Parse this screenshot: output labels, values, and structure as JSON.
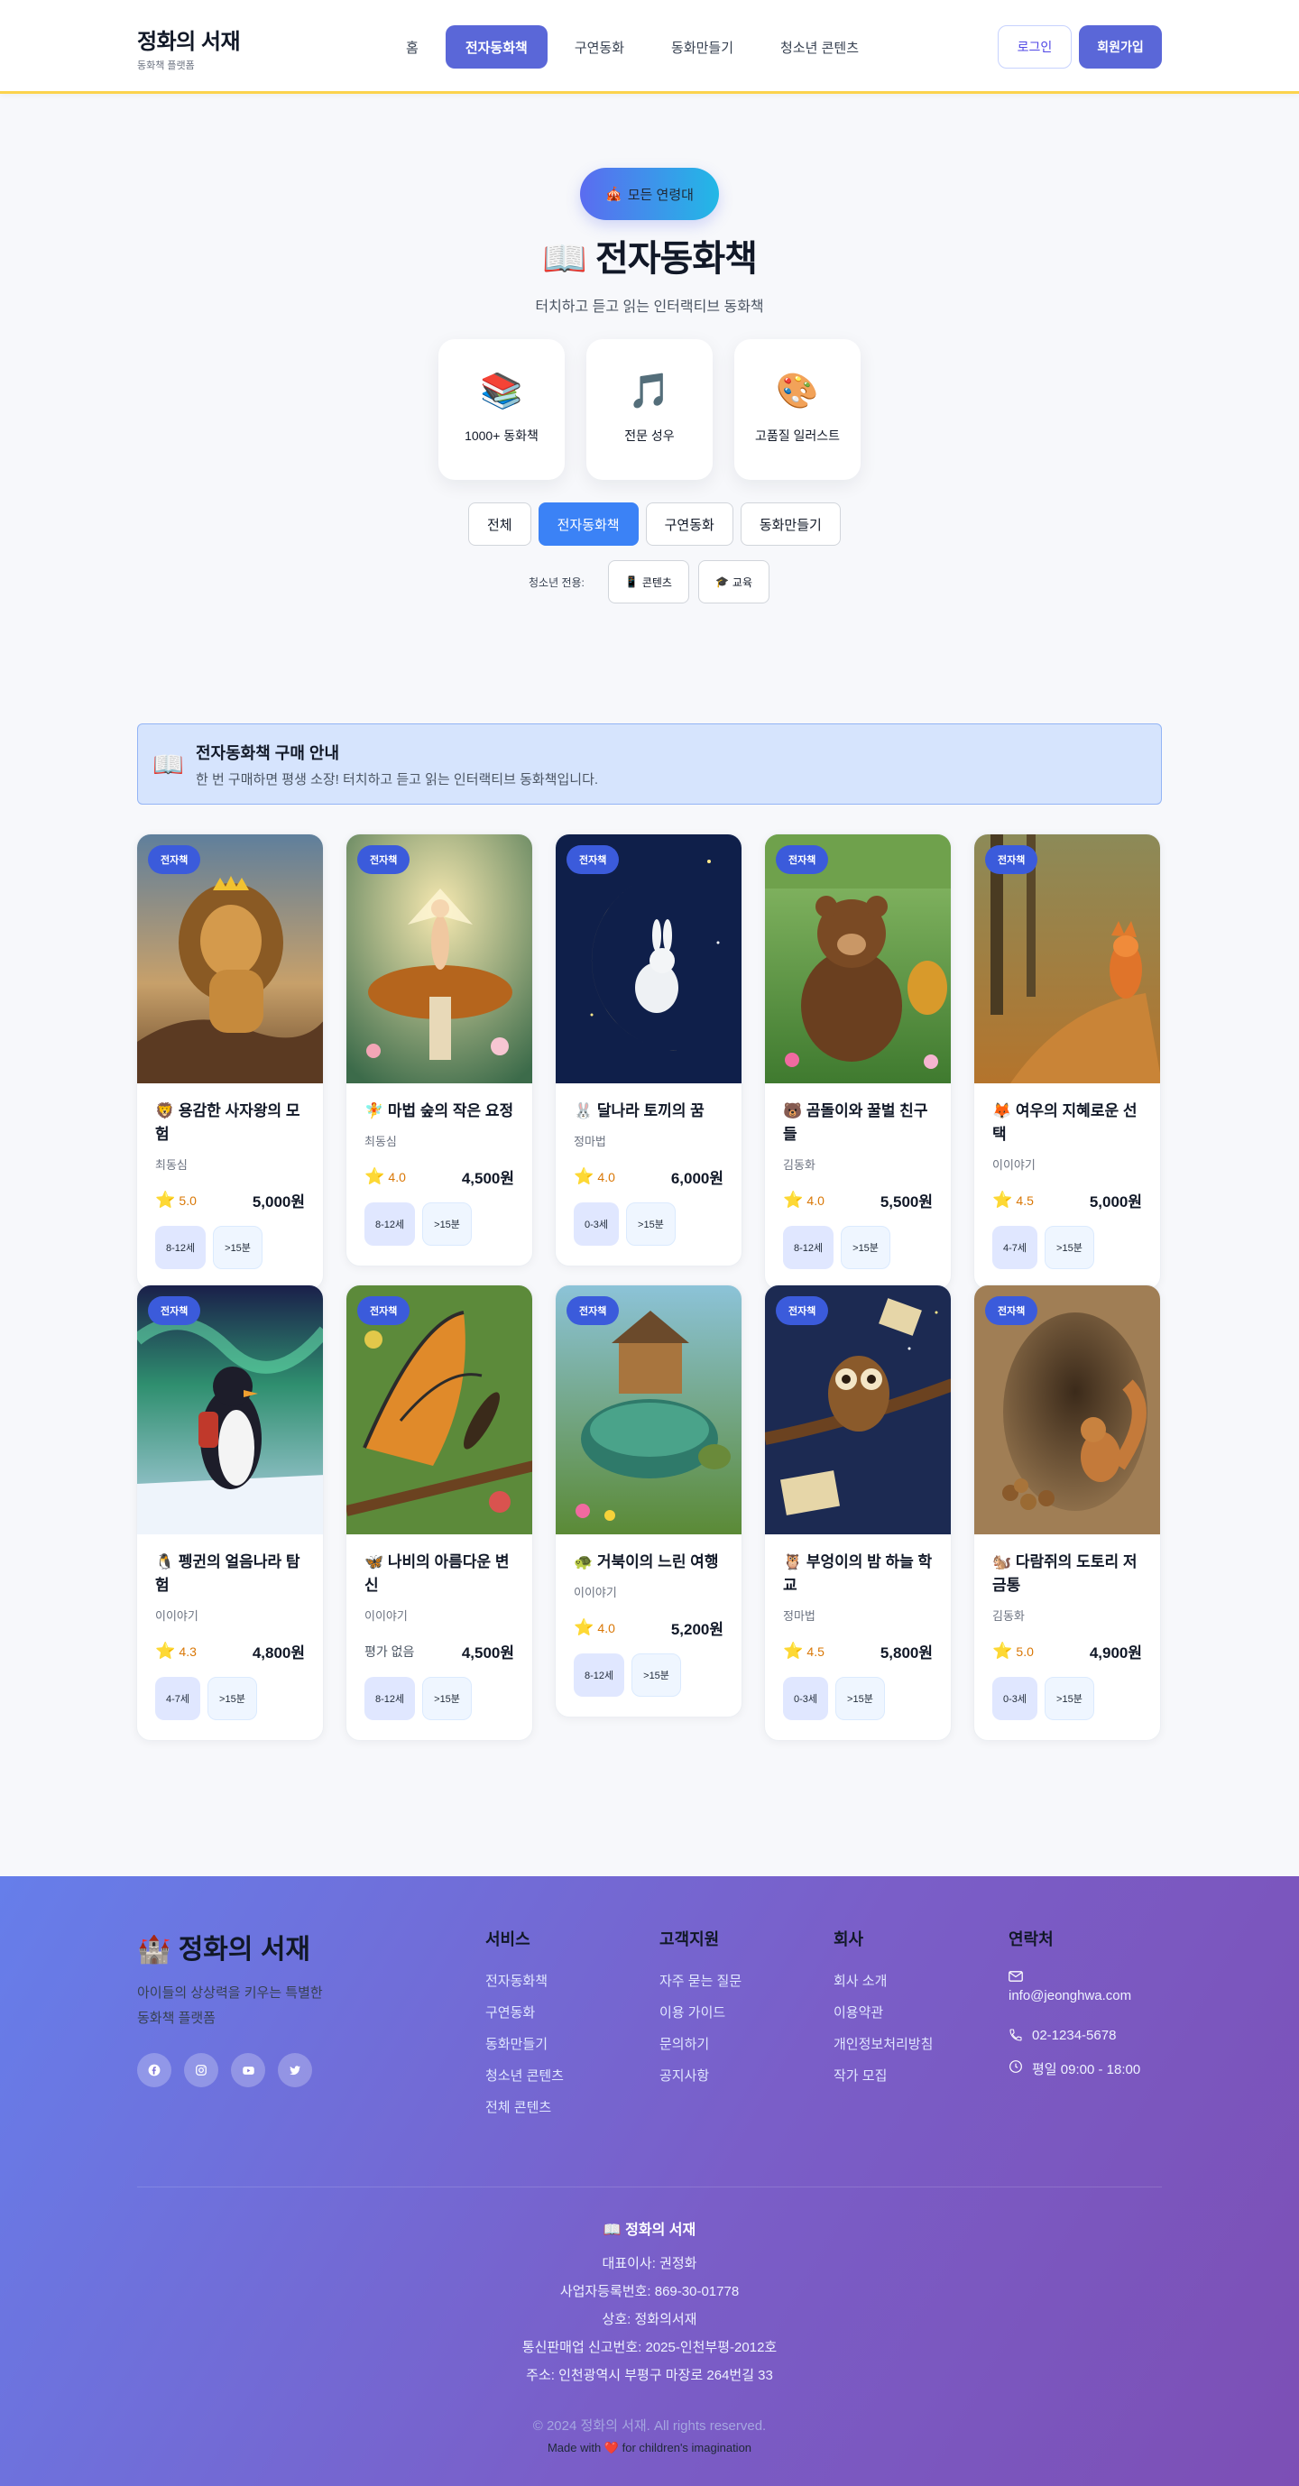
{
  "header": {
    "brand_title": "정화의 서재",
    "brand_sub": "동화책 플랫폼",
    "nav": [
      {
        "label": "홈",
        "active": false
      },
      {
        "label": "전자동화책",
        "active": true
      },
      {
        "label": "구연동화",
        "active": false
      },
      {
        "label": "동화만들기",
        "active": false
      },
      {
        "label": "청소년 콘텐츠",
        "active": false
      }
    ],
    "login": "로그인",
    "signup": "회원가입"
  },
  "hero": {
    "badge_icon": "🎪",
    "badge_label": "모든 연령대",
    "title": "📖 전자동화책",
    "subtitle": "터치하고 듣고 읽는 인터랙티브 동화책",
    "features": [
      {
        "icon": "📚",
        "label": "1000+ 동화책"
      },
      {
        "icon": "🎵",
        "label": "전문 성우"
      },
      {
        "icon": "🎨",
        "label": "고품질 일러스트"
      }
    ],
    "filters": [
      {
        "label": "전체",
        "active": false
      },
      {
        "label": "전자동화책",
        "active": true
      },
      {
        "label": "구연동화",
        "active": false
      },
      {
        "label": "동화만들기",
        "active": false
      }
    ],
    "teen_label": "청소년 전용:",
    "teen_buttons": [
      {
        "icon": "📱",
        "label": "콘텐츠"
      },
      {
        "icon": "🎓",
        "label": "교육"
      }
    ]
  },
  "notice": {
    "icon": "📖",
    "title": "전자동화책 구매 안내",
    "desc": "한 번 구매하면 평생 소장! 터치하고 듣고 읽는 인터랙티브 동화책입니다."
  },
  "books": [
    {
      "badge": "전자책",
      "title": "🦁 용감한 사자왕의 모험",
      "author": "최동심",
      "rating": "5.0",
      "price": "5,000원",
      "age": "8-12세",
      "time": ">15분",
      "scene": "lion"
    },
    {
      "badge": "전자책",
      "title": "🧚 마법 숲의 작은 요정",
      "author": "최동심",
      "rating": "4.0",
      "price": "4,500원",
      "age": "8-12세",
      "time": ">15분",
      "scene": "fairy"
    },
    {
      "badge": "전자책",
      "title": "🐰 달나라 토끼의 꿈",
      "author": "정마법",
      "rating": "4.0",
      "price": "6,000원",
      "age": "0-3세",
      "time": ">15분",
      "scene": "moon"
    },
    {
      "badge": "전자책",
      "title": "🐻 곰돌이와 꿀벌 친구들",
      "author": "김동화",
      "rating": "4.0",
      "price": "5,500원",
      "age": "8-12세",
      "time": ">15분",
      "scene": "bear"
    },
    {
      "badge": "전자책",
      "title": "🦊 여우의 지혜로운 선택",
      "author": "이이야기",
      "rating": "4.5",
      "price": "5,000원",
      "age": "4-7세",
      "time": ">15분",
      "scene": "fox"
    },
    {
      "badge": "전자책",
      "title": "🐧 펭귄의 얼음나라 탐험",
      "author": "이이야기",
      "rating": "4.3",
      "price": "4,800원",
      "age": "4-7세",
      "time": ">15분",
      "scene": "penguin"
    },
    {
      "badge": "전자책",
      "title": "🦋 나비의 아름다운 변신",
      "author": "이이야기",
      "rating": "평가 없음",
      "price": "4,500원",
      "age": "8-12세",
      "time": ">15분",
      "scene": "butterfly"
    },
    {
      "badge": "전자책",
      "title": "🐢 거북이의 느린 여행",
      "author": "이이야기",
      "rating": "4.0",
      "price": "5,200원",
      "age": "8-12세",
      "time": ">15분",
      "scene": "turtle"
    },
    {
      "badge": "전자책",
      "title": "🦉 부엉이의 밤 하늘 학교",
      "author": "정마법",
      "rating": "4.5",
      "price": "5,800원",
      "age": "0-3세",
      "time": ">15분",
      "scene": "owl"
    },
    {
      "badge": "전자책",
      "title": "🐿️ 다람쥐의 도토리 저금통",
      "author": "김동화",
      "rating": "5.0",
      "price": "4,900원",
      "age": "0-3세",
      "time": ">15분",
      "scene": "squirrel"
    }
  ],
  "footer": {
    "brand": "🏰 정화의 서재",
    "desc": "아이들의 상상력을 키우는 특별한 동화책 플랫폼",
    "socials": [
      "facebook-icon",
      "instagram-icon",
      "youtube-icon",
      "twitter-icon"
    ],
    "columns": [
      {
        "title": "서비스",
        "links": [
          "전자동화책",
          "구연동화",
          "동화만들기",
          "청소년 콘텐츠",
          "전체 콘텐츠"
        ]
      },
      {
        "title": "고객지원",
        "links": [
          "자주 묻는 질문",
          "이용 가이드",
          "문의하기",
          "공지사항"
        ]
      },
      {
        "title": "회사",
        "links": [
          "회사 소개",
          "이용약관",
          "개인정보처리방침",
          "작가 모집"
        ]
      }
    ],
    "contact_title": "연락처",
    "contact": {
      "email": "info@jeonghwa.com",
      "phone": "02-1234-5678",
      "hours": "평일 09:00 - 18:00"
    },
    "bottom_title": "📖 정화의 서재",
    "info": [
      "대표이사: 권정화",
      "사업자등록번호: 869-30-01778",
      "상호: 정화의서재",
      "통신판매업 신고번호: 2025-인천부평-2012호",
      "주소: 인천광역시 부평구 마장로 264번길 33"
    ],
    "copyright": "© 2024 정화의 서재. All rights reserved.",
    "made_with_pre": "Made with",
    "made_with_heart": "❤️",
    "made_with_post": "for children's imagination"
  },
  "colors": {
    "accent": "#5a67d8",
    "primary_blue": "#3b82f6",
    "badge_blue": "#3b5bdb",
    "rating": "#d97706",
    "footer_start": "#667eea",
    "footer_end": "#7c4fb5"
  }
}
